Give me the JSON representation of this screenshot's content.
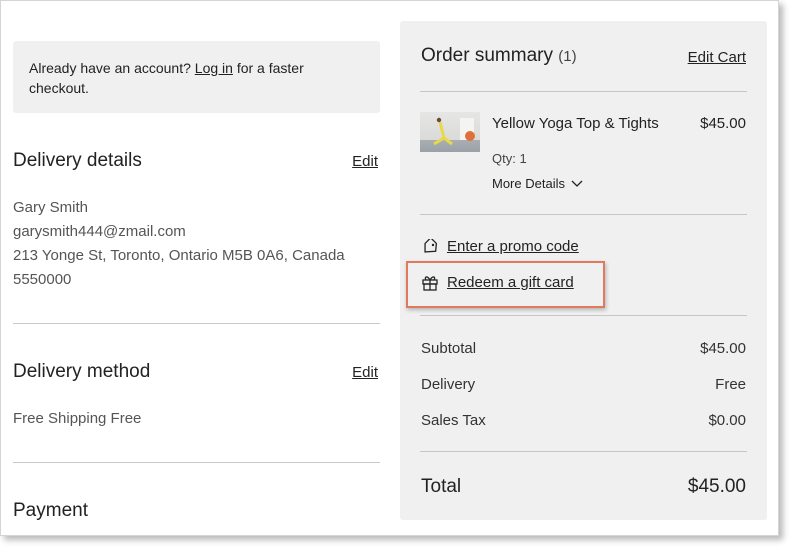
{
  "login": {
    "prefix": "Already have an account? ",
    "link": "Log in",
    "suffix": " for a faster checkout."
  },
  "delivery_details": {
    "title": "Delivery details",
    "edit": "Edit",
    "name": "Gary Smith",
    "email": "garysmith444@zmail.com",
    "address": "213 Yonge St, Toronto, Ontario M5B 0A6, Canada",
    "phone": "5550000"
  },
  "delivery_method": {
    "title": "Delivery method",
    "edit": "Edit",
    "value": "Free Shipping Free"
  },
  "payment": {
    "title": "Payment"
  },
  "summary": {
    "title": "Order summary",
    "count": "(1)",
    "edit_cart": "Edit Cart",
    "item": {
      "name": "Yellow Yoga Top & Tights",
      "price": "$45.00",
      "qty": "Qty: 1",
      "more_details": "More Details"
    },
    "promo": "Enter a promo code",
    "gift_card": "Redeem a gift card",
    "rows": {
      "subtotal_label": "Subtotal",
      "subtotal_value": "$45.00",
      "delivery_label": "Delivery",
      "delivery_value": "Free",
      "tax_label": "Sales Tax",
      "tax_value": "$0.00"
    },
    "total_label": "Total",
    "total_value": "$45.00"
  },
  "colors": {
    "panel_bg": "#f0f0f0",
    "highlight": "#e07a5f",
    "text": "#222222"
  }
}
